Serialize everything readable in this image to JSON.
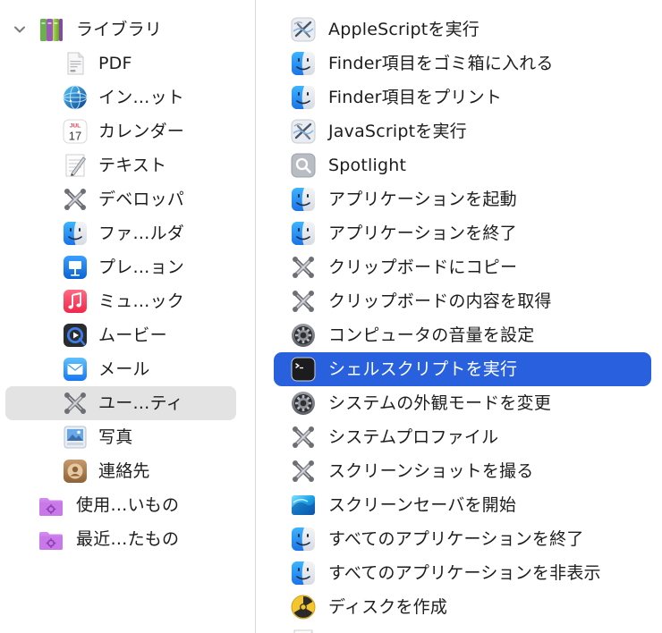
{
  "library": {
    "label": "ライブラリ",
    "categories": [
      {
        "label": "PDF",
        "icon": "pdf-icon"
      },
      {
        "label": "イン…ット",
        "icon": "internet-icon"
      },
      {
        "label": "カレンダー",
        "icon": "calendar-icon",
        "calendar_month": "JUL",
        "calendar_day": "17"
      },
      {
        "label": "テキスト",
        "icon": "text-icon"
      },
      {
        "label": "デベロッパ",
        "icon": "developer-icon"
      },
      {
        "label": "ファ…ルダ",
        "icon": "finder-icon"
      },
      {
        "label": "プレ…ョン",
        "icon": "presentation-icon"
      },
      {
        "label": "ミュ…ック",
        "icon": "music-icon"
      },
      {
        "label": "ムービー",
        "icon": "movie-icon"
      },
      {
        "label": "メール",
        "icon": "mail-icon"
      },
      {
        "label": "ユー…ティ",
        "icon": "utilities-icon",
        "selected": true
      },
      {
        "label": "写真",
        "icon": "photos-icon"
      },
      {
        "label": "連絡先",
        "icon": "contacts-icon"
      }
    ],
    "smart_folders": [
      {
        "label": "使用…いもの",
        "icon": "smart-folder-icon"
      },
      {
        "label": "最近…たもの",
        "icon": "smart-folder-icon"
      }
    ]
  },
  "actions": [
    {
      "label": "AppleScriptを実行",
      "icon": "script-editor-icon"
    },
    {
      "label": "Finder項目をゴミ箱に入れる",
      "icon": "finder-icon"
    },
    {
      "label": "Finder項目をプリント",
      "icon": "finder-icon"
    },
    {
      "label": "JavaScriptを実行",
      "icon": "script-editor-icon"
    },
    {
      "label": "Spotlight",
      "icon": "spotlight-icon"
    },
    {
      "label": "アプリケーションを起動",
      "icon": "finder-icon"
    },
    {
      "label": "アプリケーションを終了",
      "icon": "finder-icon"
    },
    {
      "label": "クリップボードにコピー",
      "icon": "utilities-icon"
    },
    {
      "label": "クリップボードの内容を取得",
      "icon": "utilities-icon"
    },
    {
      "label": "コンピュータの音量を設定",
      "icon": "system-settings-icon"
    },
    {
      "label": "シェルスクリプトを実行",
      "icon": "terminal-icon",
      "selected": true
    },
    {
      "label": "システムの外観モードを変更",
      "icon": "system-settings-icon"
    },
    {
      "label": "システムプロファイル",
      "icon": "utilities-icon"
    },
    {
      "label": "スクリーンショットを撮る",
      "icon": "utilities-icon"
    },
    {
      "label": "スクリーンセーバを開始",
      "icon": "screensaver-icon"
    },
    {
      "label": "すべてのアプリケーションを終了",
      "icon": "finder-icon"
    },
    {
      "label": "すべてのアプリケーションを非表示",
      "icon": "finder-icon"
    },
    {
      "label": "ディスクを作成",
      "icon": "burn-icon"
    }
  ],
  "colors": {
    "selection_blue": "#2860dd",
    "sidebar_selected": "#e3e3e3",
    "divider": "#d9d9d9"
  }
}
